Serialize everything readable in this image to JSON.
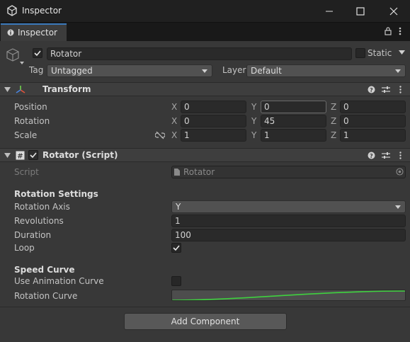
{
  "window": {
    "title": "Inspector"
  },
  "tab": {
    "label": "Inspector"
  },
  "object": {
    "name": "Rotator",
    "static_label": "Static",
    "tag_label": "Tag",
    "tag_value": "Untagged",
    "layer_label": "Layer",
    "layer_value": "Default"
  },
  "transform": {
    "title": "Transform",
    "rows": [
      {
        "label": "Position",
        "x": "0",
        "y": "0",
        "z": "0"
      },
      {
        "label": "Rotation",
        "x": "0",
        "y": "45",
        "z": "0"
      },
      {
        "label": "Scale",
        "x": "1",
        "y": "1",
        "z": "1"
      }
    ],
    "axes": [
      "X",
      "Y",
      "Z"
    ]
  },
  "script": {
    "title": "Rotator (Script)",
    "script_label": "Script",
    "script_value": "Rotator",
    "rotation_settings": "Rotation Settings",
    "rotation_axis_label": "Rotation Axis",
    "rotation_axis_value": "Y",
    "revolutions_label": "Revolutions",
    "revolutions_value": "1",
    "duration_label": "Duration",
    "duration_value": "100",
    "loop_label": "Loop",
    "speed_curve": "Speed Curve",
    "use_anim_label": "Use Animation Curve",
    "rotation_curve_label": "Rotation Curve"
  },
  "add_component": "Add Component",
  "colors": {
    "accent": "#3a79bb",
    "curve": "#3fd13f",
    "background": "#383838"
  }
}
